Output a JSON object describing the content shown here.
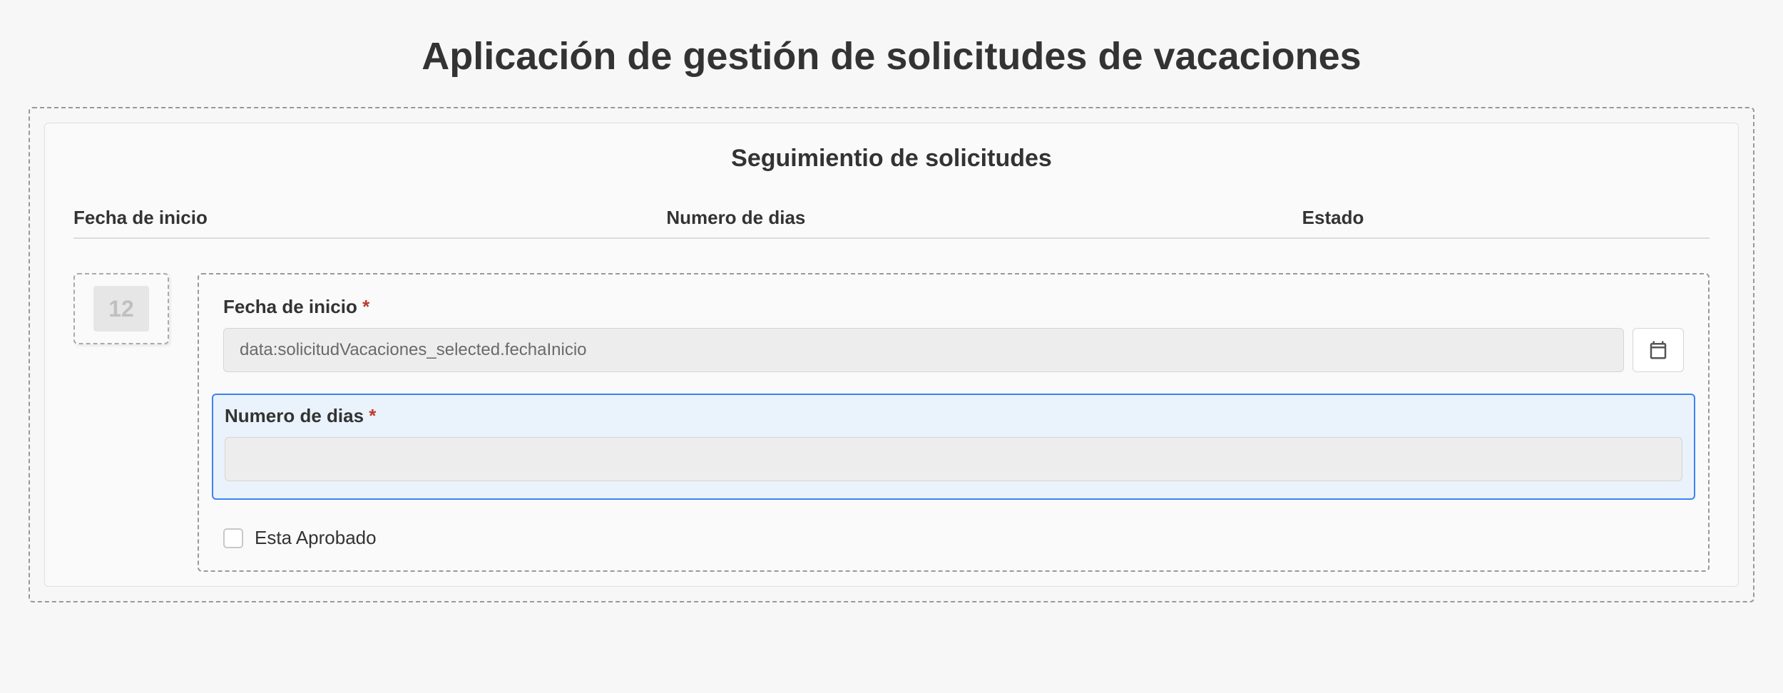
{
  "app": {
    "title": "Aplicación de gestión de solicitudes de vacaciones"
  },
  "section": {
    "title": "Seguimientio de solicitudes"
  },
  "columns": {
    "c1": "Fecha de inicio",
    "c2": "Numero de dias",
    "c3": "Estado"
  },
  "placeholder": {
    "number": "12"
  },
  "form": {
    "fechaInicio": {
      "label": "Fecha de inicio",
      "required": "*",
      "placeholder": "data:solicitudVacaciones_selected.fechaInicio",
      "value": ""
    },
    "numeroDias": {
      "label": "Numero de dias",
      "required": "*",
      "value": ""
    },
    "estaAprobado": {
      "label": "Esta Aprobado",
      "checked": false
    }
  }
}
